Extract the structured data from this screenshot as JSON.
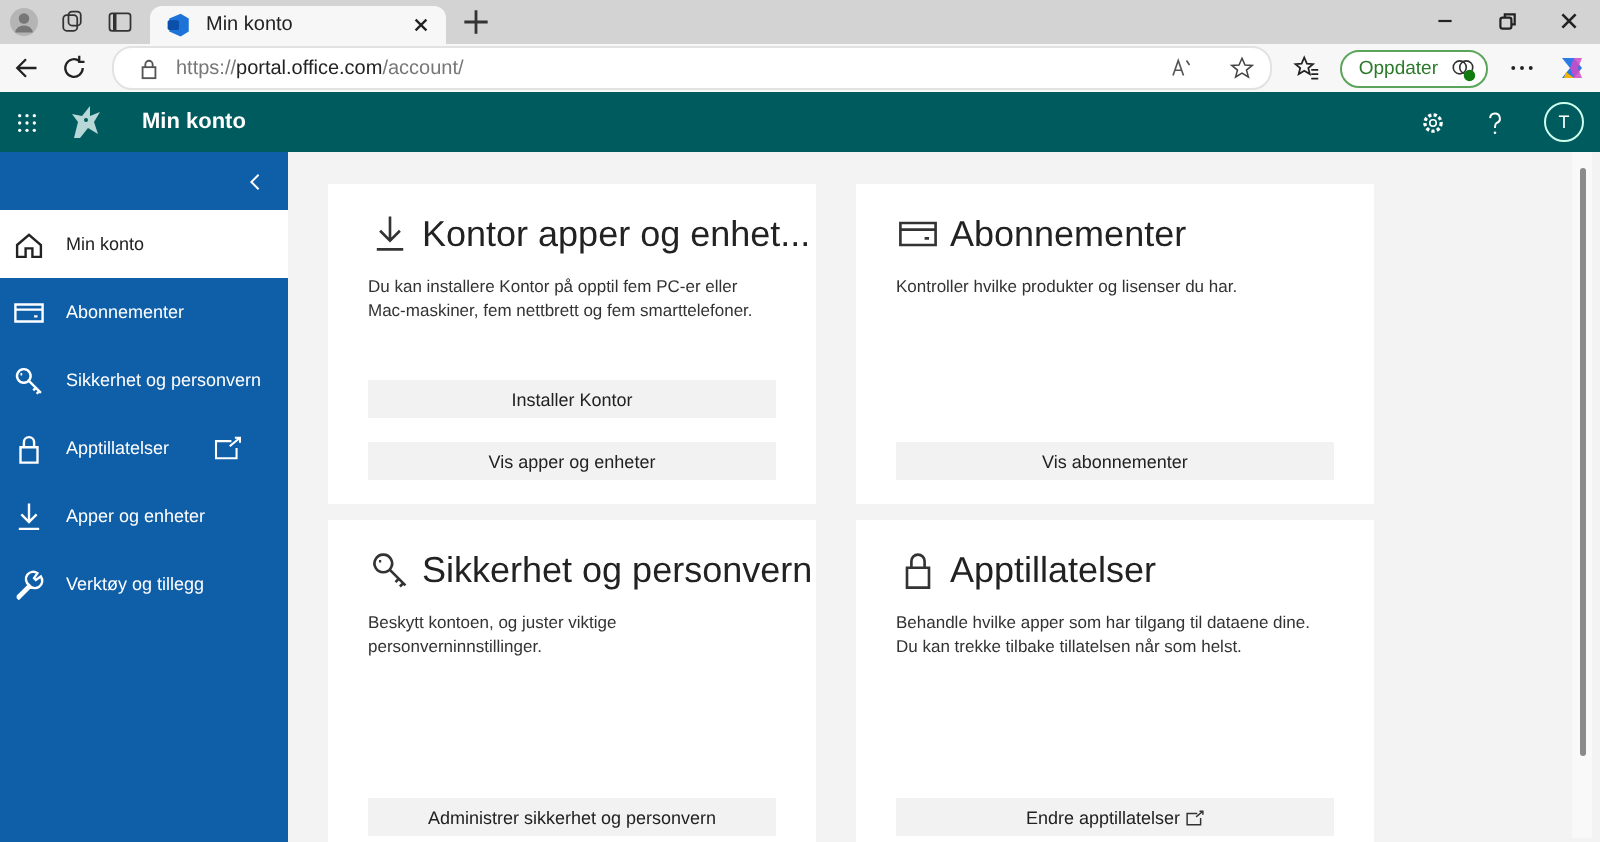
{
  "browser": {
    "tab_title": "Min konto",
    "url_prefix": "https://",
    "url_host": "portal.office.com",
    "url_path": "/account/",
    "update_button": "Oppdater"
  },
  "header": {
    "title": "Min konto",
    "avatar_initial": "T"
  },
  "sidebar": {
    "items": [
      {
        "kind": "home",
        "label": "Min konto",
        "selected": true,
        "external": false
      },
      {
        "kind": "card",
        "label": "Abonnementer",
        "selected": false,
        "external": false
      },
      {
        "kind": "key",
        "label": "Sikkerhet og personvern",
        "selected": false,
        "external": false
      },
      {
        "kind": "lock",
        "label": "Apptillatelser",
        "selected": false,
        "external": true
      },
      {
        "kind": "download",
        "label": "Apper og enheter",
        "selected": false,
        "external": false
      },
      {
        "kind": "wrench",
        "label": "Verktøy og tillegg",
        "selected": false,
        "external": false
      }
    ]
  },
  "cards": [
    {
      "kind": "download",
      "title": "Kontor apper og enhet...",
      "description": "Du kan installere Kontor på opptil fem PC-er eller Mac-maskiner, fem nettbrett og fem smarttelefoner.",
      "buttons": [
        {
          "label": "Installer Kontor",
          "external": false
        },
        {
          "label": "Vis apper og enheter",
          "external": false
        }
      ]
    },
    {
      "kind": "card",
      "title": "Abonnementer",
      "description": "Kontroller hvilke produkter og lisenser du har.",
      "buttons": [
        {
          "label": "Vis abonnementer",
          "external": false
        }
      ]
    },
    {
      "kind": "key",
      "title": "Sikkerhet og personvern",
      "description": "Beskytt kontoen, og juster viktige personverninnstillinger.",
      "buttons": [
        {
          "label": "Administrer sikkerhet og personvern",
          "external": false
        }
      ]
    },
    {
      "kind": "lock",
      "title": "Apptillatelser",
      "description": "Behandle hvilke apper som har tilgang til dataene dine. Du kan trekke tilbake tillatelsen når som helst.",
      "buttons": [
        {
          "label": "Endre apptillatelser",
          "external": true
        }
      ]
    }
  ]
}
